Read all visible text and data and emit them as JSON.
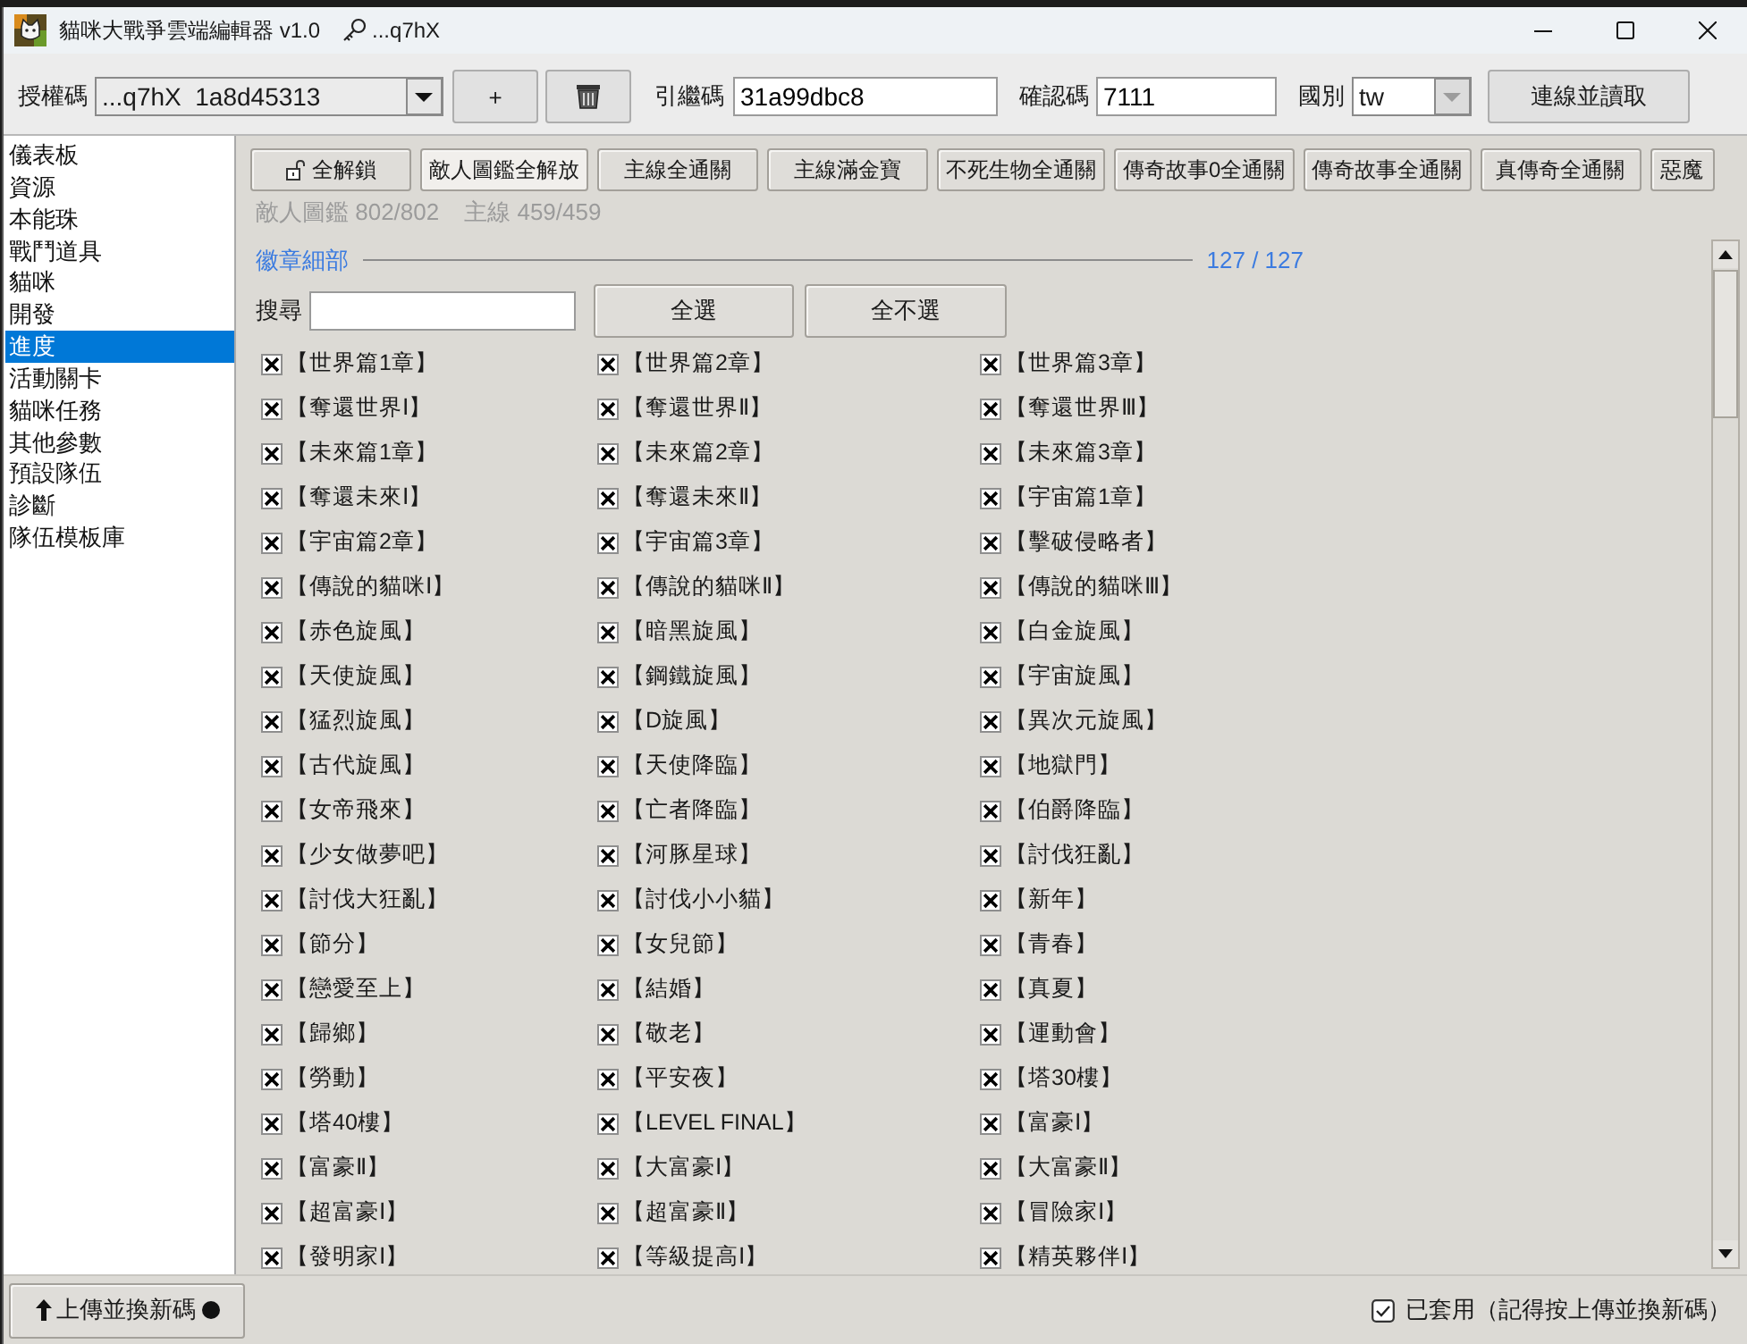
{
  "window": {
    "title": "貓咪大戰爭雲端編輯器 v1.0",
    "key_label": "...q7hX"
  },
  "toolbar": {
    "auth_label": "授權碼",
    "auth_value": "...q7hX  1a8d45313",
    "add_button": "+",
    "transfer_label": "引繼碼",
    "transfer_value": "31a99dbc8",
    "confirm_label": "確認碼",
    "confirm_value": "7111",
    "country_label": "國別",
    "country_value": "tw",
    "connect_button": "連線並讀取"
  },
  "sidebar": {
    "items": [
      {
        "label": "儀表板",
        "selected": false
      },
      {
        "label": "資源",
        "selected": false
      },
      {
        "label": "本能珠",
        "selected": false
      },
      {
        "label": "戰鬥道具",
        "selected": false
      },
      {
        "label": "貓咪",
        "selected": false
      },
      {
        "label": "開發",
        "selected": false
      },
      {
        "label": "進度",
        "selected": true
      },
      {
        "label": "活動關卡",
        "selected": false
      },
      {
        "label": "貓咪任務",
        "selected": false
      },
      {
        "label": "其他參數",
        "selected": false
      },
      {
        "label": "預設隊伍",
        "selected": false
      },
      {
        "label": "診斷",
        "selected": false
      },
      {
        "label": "隊伍模板庫",
        "selected": false
      }
    ]
  },
  "actions": [
    {
      "label": "全解鎖",
      "kind": "lock",
      "hovered": false
    },
    {
      "label": "敵人圖鑑全解放",
      "kind": "plain",
      "hovered": true
    },
    {
      "label": "主線全通關",
      "kind": "plain",
      "hovered": false
    },
    {
      "label": "主線滿金寶",
      "kind": "plain",
      "hovered": false
    },
    {
      "label": "不死生物全通關",
      "kind": "plain",
      "hovered": false
    },
    {
      "label": "傳奇故事0全通關",
      "kind": "plain",
      "hovered": false
    },
    {
      "label": "傳奇故事全通關",
      "kind": "plain",
      "hovered": false
    },
    {
      "label": "真傳奇全通關",
      "kind": "plain",
      "hovered": false
    },
    {
      "label": "惡魔",
      "kind": "plain",
      "hovered": false
    }
  ],
  "stats": [
    "敵人圖鑑 802/802",
    "主線 459/459"
  ],
  "badges": {
    "title": "徽章細部",
    "count": "127 / 127",
    "search_label": "搜尋",
    "select_all": "全選",
    "select_none": "全不選",
    "items": [
      {
        "label": "【世界篇1章】",
        "checked": true
      },
      {
        "label": "【世界篇2章】",
        "checked": true
      },
      {
        "label": "【世界篇3章】",
        "checked": true
      },
      {
        "label": "【奪還世界Ⅰ】",
        "checked": true
      },
      {
        "label": "【奪還世界Ⅱ】",
        "checked": true
      },
      {
        "label": "【奪還世界Ⅲ】",
        "checked": true
      },
      {
        "label": "【未來篇1章】",
        "checked": true
      },
      {
        "label": "【未來篇2章】",
        "checked": true
      },
      {
        "label": "【未來篇3章】",
        "checked": true
      },
      {
        "label": "【奪還未來Ⅰ】",
        "checked": true
      },
      {
        "label": "【奪還未來Ⅱ】",
        "checked": true
      },
      {
        "label": "【宇宙篇1章】",
        "checked": true
      },
      {
        "label": "【宇宙篇2章】",
        "checked": true
      },
      {
        "label": "【宇宙篇3章】",
        "checked": true
      },
      {
        "label": "【擊破侵略者】",
        "checked": true
      },
      {
        "label": "【傳說的貓咪Ⅰ】",
        "checked": true
      },
      {
        "label": "【傳說的貓咪Ⅱ】",
        "checked": true
      },
      {
        "label": "【傳說的貓咪Ⅲ】",
        "checked": true
      },
      {
        "label": "【赤色旋風】",
        "checked": true
      },
      {
        "label": "【暗黑旋風】",
        "checked": true
      },
      {
        "label": "【白金旋風】",
        "checked": true
      },
      {
        "label": "【天使旋風】",
        "checked": true
      },
      {
        "label": "【鋼鐵旋風】",
        "checked": true
      },
      {
        "label": "【宇宙旋風】",
        "checked": true
      },
      {
        "label": "【猛烈旋風】",
        "checked": true
      },
      {
        "label": "【D旋風】",
        "checked": true
      },
      {
        "label": "【異次元旋風】",
        "checked": true
      },
      {
        "label": "【古代旋風】",
        "checked": true
      },
      {
        "label": "【天使降臨】",
        "checked": true
      },
      {
        "label": "【地獄門】",
        "checked": true
      },
      {
        "label": "【女帝飛來】",
        "checked": true
      },
      {
        "label": "【亡者降臨】",
        "checked": true
      },
      {
        "label": "【伯爵降臨】",
        "checked": true
      },
      {
        "label": "【少女做夢吧】",
        "checked": true
      },
      {
        "label": "【河豚星球】",
        "checked": true
      },
      {
        "label": "【討伐狂亂】",
        "checked": true
      },
      {
        "label": "【討伐大狂亂】",
        "checked": true
      },
      {
        "label": "【討伐小小貓】",
        "checked": true
      },
      {
        "label": "【新年】",
        "checked": true
      },
      {
        "label": "【節分】",
        "checked": true
      },
      {
        "label": "【女兒節】",
        "checked": true
      },
      {
        "label": "【青春】",
        "checked": true
      },
      {
        "label": "【戀愛至上】",
        "checked": true
      },
      {
        "label": "【結婚】",
        "checked": true
      },
      {
        "label": "【真夏】",
        "checked": true
      },
      {
        "label": "【歸鄉】",
        "checked": true
      },
      {
        "label": "【敬老】",
        "checked": true
      },
      {
        "label": "【運動會】",
        "checked": true
      },
      {
        "label": "【勞動】",
        "checked": true
      },
      {
        "label": "【平安夜】",
        "checked": true
      },
      {
        "label": "【塔30樓】",
        "checked": true
      },
      {
        "label": "【塔40樓】",
        "checked": true
      },
      {
        "label": "【LEVEL FINAL】",
        "checked": true
      },
      {
        "label": "【富豪Ⅰ】",
        "checked": true
      },
      {
        "label": "【富豪Ⅱ】",
        "checked": true
      },
      {
        "label": "【大富豪Ⅰ】",
        "checked": true
      },
      {
        "label": "【大富豪Ⅱ】",
        "checked": true
      },
      {
        "label": "【超富豪Ⅰ】",
        "checked": true
      },
      {
        "label": "【超富豪Ⅱ】",
        "checked": true
      },
      {
        "label": "【冒險家Ⅰ】",
        "checked": true
      },
      {
        "label": "【發明家Ⅰ】",
        "checked": true
      },
      {
        "label": "【等級提高Ⅰ】",
        "checked": true
      },
      {
        "label": "【精英夥伴Ⅰ】",
        "checked": true
      }
    ]
  },
  "footer": {
    "upload_button": "上傳並換新碼",
    "applied": {
      "label": "已套用（記得按上傳並換新碼）",
      "checked": true
    }
  }
}
